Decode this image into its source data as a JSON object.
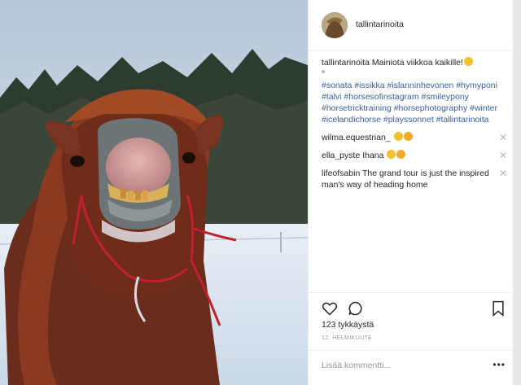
{
  "post": {
    "username": "tallintarinoita",
    "caption_user": "tallintarinoita",
    "caption_text": "Mainiota viikkoa kaikille!",
    "caption_emoji": "face-savouring-emoji",
    "caption_tail": "°",
    "hashtags": "#sonata #issikka #islanninhevonen #hymyponi #talvi #horsesofinstagram #smileypony #horsetricktraining #horsephotography #winter #icelandichorse #playssonnet #tallintarinoita",
    "likes": "123 tykkäystä",
    "date": "12. HELMIKUUTA",
    "add_comment_placeholder": "Lisää kommentti...",
    "more_label": "•••"
  },
  "comments": [
    {
      "user": "wilma.equestrian_",
      "text": "",
      "emojis": [
        "grinning-sweat-emoji",
        "heart-eyes-emoji"
      ],
      "remove": "✕"
    },
    {
      "user": "ella_pyste",
      "text": "Ihana",
      "emojis": [
        "grinning-sweat-emoji",
        "heart-eyes-emoji"
      ],
      "remove": "✕"
    },
    {
      "user": "lifeofsabin",
      "text": "The grand tour is just the inspired man's way of heading home",
      "emojis": [],
      "remove": "✕"
    }
  ],
  "icons": {
    "like": "heart-icon",
    "comment": "comment-bubble-icon",
    "save": "bookmark-icon"
  },
  "colors": {
    "hashtag": "#3a5fa0",
    "muted": "#999999",
    "text": "#262626",
    "emoji": "#f2c12e"
  }
}
